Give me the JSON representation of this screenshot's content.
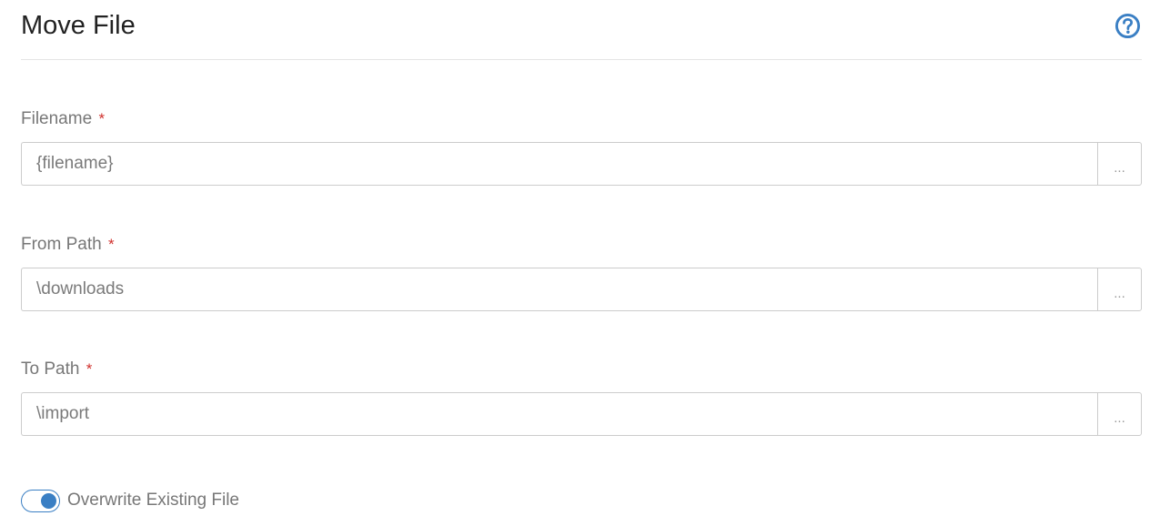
{
  "header": {
    "title": "Move File",
    "help_icon": "question-circle-icon"
  },
  "colors": {
    "accent": "#3a7fc4",
    "required": "#d0312d",
    "label": "#777777",
    "border": "#cccccc"
  },
  "fields": [
    {
      "label": "Filename",
      "required_mark": "*",
      "value": "{filename}",
      "browse_label": "..."
    },
    {
      "label": "From Path",
      "required_mark": "*",
      "value": "\\downloads",
      "browse_label": "..."
    },
    {
      "label": "To Path",
      "required_mark": "*",
      "value": "\\import",
      "browse_label": "..."
    }
  ],
  "overwrite": {
    "label": "Overwrite Existing File",
    "checked": true
  }
}
